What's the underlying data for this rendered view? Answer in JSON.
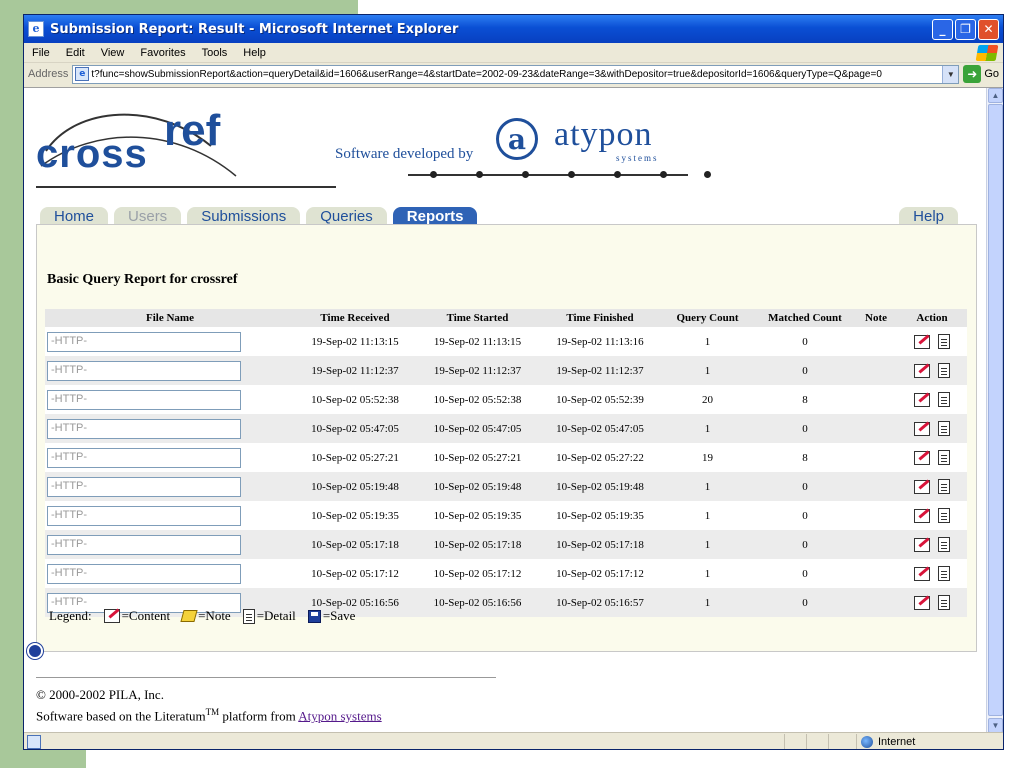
{
  "window": {
    "title": "Submission Report: Result - Microsoft Internet Explorer",
    "min_glyph": "_",
    "max_glyph": "❐",
    "close_glyph": "✕"
  },
  "menu": [
    "File",
    "Edit",
    "View",
    "Favorites",
    "Tools",
    "Help"
  ],
  "address": {
    "label": "Address",
    "url": "t?func=showSubmissionReport&action=queryDetail&id=1606&userRange=4&startDate=2002-09-23&dateRange=3&withDepositor=true&depositorId=1606&queryType=Q&page=0",
    "go_label": "Go"
  },
  "header": {
    "logo_part1": "cross",
    "logo_part2": "ref",
    "developed_by": "Software developed by",
    "vendor_mark": "a",
    "vendor_name": "atypon",
    "vendor_tag": "systems"
  },
  "tabs": [
    {
      "label": "Home",
      "state": "normal"
    },
    {
      "label": "Users",
      "state": "disabled"
    },
    {
      "label": "Submissions",
      "state": "normal"
    },
    {
      "label": "Queries",
      "state": "normal"
    },
    {
      "label": "Reports",
      "state": "active"
    }
  ],
  "help_tab": "Help",
  "report": {
    "title": "Basic Query Report for crossref",
    "columns": [
      "File Name",
      "Time Received",
      "Time Started",
      "Time Finished",
      "Query Count",
      "Matched Count",
      "Note",
      "Action"
    ],
    "rows": [
      {
        "file": "-HTTP-",
        "received": "19-Sep-02 11:13:15",
        "started": "19-Sep-02 11:13:15",
        "finished": "19-Sep-02 11:13:16",
        "query_count": "1",
        "matched_count": "0",
        "note": ""
      },
      {
        "file": "-HTTP-",
        "received": "19-Sep-02 11:12:37",
        "started": "19-Sep-02 11:12:37",
        "finished": "19-Sep-02 11:12:37",
        "query_count": "1",
        "matched_count": "0",
        "note": ""
      },
      {
        "file": "-HTTP-",
        "received": "10-Sep-02 05:52:38",
        "started": "10-Sep-02 05:52:38",
        "finished": "10-Sep-02 05:52:39",
        "query_count": "20",
        "matched_count": "8",
        "note": ""
      },
      {
        "file": "-HTTP-",
        "received": "10-Sep-02 05:47:05",
        "started": "10-Sep-02 05:47:05",
        "finished": "10-Sep-02 05:47:05",
        "query_count": "1",
        "matched_count": "0",
        "note": ""
      },
      {
        "file": "-HTTP-",
        "received": "10-Sep-02 05:27:21",
        "started": "10-Sep-02 05:27:21",
        "finished": "10-Sep-02 05:27:22",
        "query_count": "19",
        "matched_count": "8",
        "note": ""
      },
      {
        "file": "-HTTP-",
        "received": "10-Sep-02 05:19:48",
        "started": "10-Sep-02 05:19:48",
        "finished": "10-Sep-02 05:19:48",
        "query_count": "1",
        "matched_count": "0",
        "note": ""
      },
      {
        "file": "-HTTP-",
        "received": "10-Sep-02 05:19:35",
        "started": "10-Sep-02 05:19:35",
        "finished": "10-Sep-02 05:19:35",
        "query_count": "1",
        "matched_count": "0",
        "note": ""
      },
      {
        "file": "-HTTP-",
        "received": "10-Sep-02 05:17:18",
        "started": "10-Sep-02 05:17:18",
        "finished": "10-Sep-02 05:17:18",
        "query_count": "1",
        "matched_count": "0",
        "note": ""
      },
      {
        "file": "-HTTP-",
        "received": "10-Sep-02 05:17:12",
        "started": "10-Sep-02 05:17:12",
        "finished": "10-Sep-02 05:17:12",
        "query_count": "1",
        "matched_count": "0",
        "note": ""
      },
      {
        "file": "-HTTP-",
        "received": "10-Sep-02 05:16:56",
        "started": "10-Sep-02 05:16:56",
        "finished": "10-Sep-02 05:16:57",
        "query_count": "1",
        "matched_count": "0",
        "note": ""
      }
    ]
  },
  "legend": {
    "label": "Legend:",
    "content": "=Content",
    "note": "=Note",
    "detail": "=Detail",
    "save": "=Save"
  },
  "footer": {
    "copyright": "© 2000-2002 PILA, Inc.",
    "based_prefix": "Software based on the Literatum",
    "tm": "TM",
    "based_middle": " platform from ",
    "link": "Atypon systems"
  },
  "status": {
    "zone": "Internet"
  },
  "colors": {
    "brand_blue": "#1f4f9b",
    "active_tab": "#2f63b6",
    "panel_bg": "#fbfbec",
    "slide_green": "#a8c89a"
  }
}
